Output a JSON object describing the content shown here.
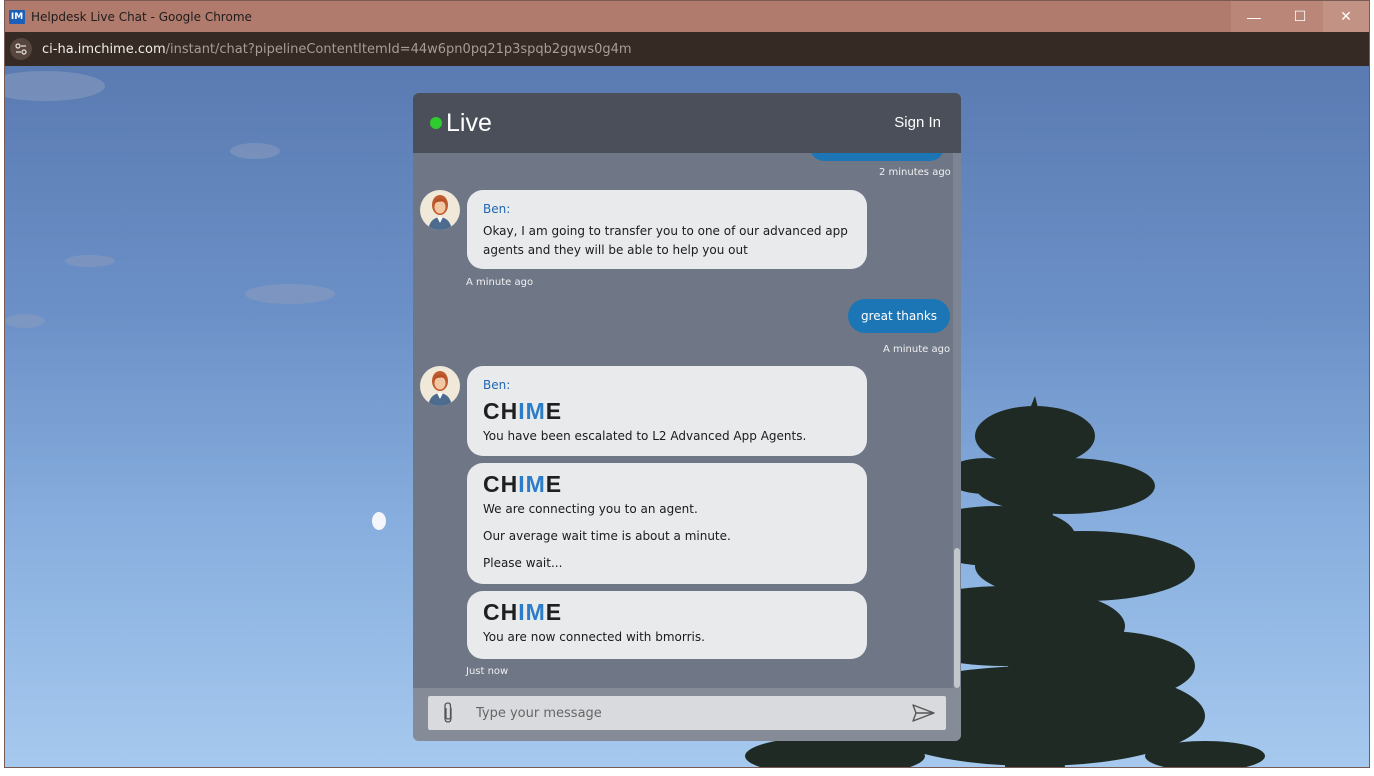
{
  "window": {
    "title": "Helpdesk Live Chat - Google Chrome",
    "app_icon_text": "IM",
    "minimize_glyph": "—",
    "maximize_glyph": "☐",
    "close_glyph": "✕"
  },
  "address": {
    "host": "ci-ha.imchime.com",
    "path": "/instant/chat?pipelineContentItemId=44w6pn0pq21p3spqb2gqws0g4m"
  },
  "chat": {
    "status": "Live",
    "status_color": "#2ecc2e",
    "sign_in": "Sign In",
    "messages": [
      {
        "type": "outgoing-partial",
        "timestamp": "2 minutes ago"
      },
      {
        "type": "incoming",
        "sender": "Ben:",
        "text": "Okay, I am going to transfer you to one of our advanced app agents and they will be able to help you out",
        "timestamp": "A minute ago"
      },
      {
        "type": "outgoing",
        "text": "great thanks",
        "timestamp": "A minute ago"
      },
      {
        "type": "incoming",
        "sender": "Ben:",
        "logo": [
          "CH",
          "IM",
          "E"
        ],
        "text": "You have been escalated to L2 Advanced App Agents."
      },
      {
        "type": "system",
        "logo": [
          "CH",
          "IM",
          "E"
        ],
        "lines": [
          "We are connecting you to an agent.",
          "Our average wait time is about a minute.",
          "Please wait..."
        ]
      },
      {
        "type": "system",
        "logo": [
          "CH",
          "IM",
          "E"
        ],
        "text": "You are now connected with bmorris.",
        "timestamp": "Just now"
      }
    ],
    "composer": {
      "placeholder": "Type your message"
    },
    "colors": {
      "outgoing_bubble": "#1c76b5",
      "sender_name": "#1f67b1",
      "logo_accent": "#2a7dc6"
    }
  }
}
